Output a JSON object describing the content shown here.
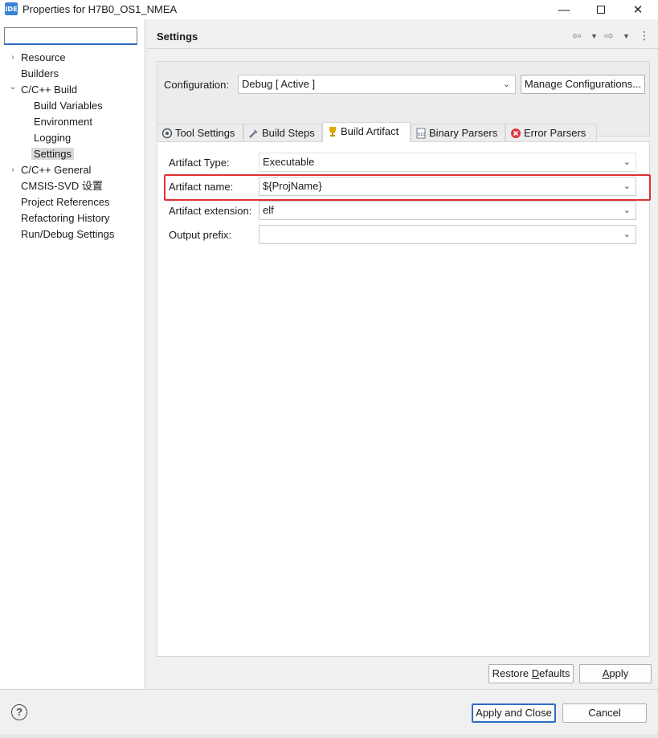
{
  "window": {
    "app_icon_text": "IDE",
    "title": "Properties for H7B0_OS1_NMEA",
    "minimize": "—",
    "close": "✕"
  },
  "filter": {
    "value": ""
  },
  "tree": [
    {
      "label": "Resource",
      "arrow": "›"
    },
    {
      "label": "Builders",
      "arrow": ""
    },
    {
      "label": "C/C++ Build",
      "arrow": "⌄"
    },
    {
      "label": "Build Variables",
      "arrow": ""
    },
    {
      "label": "Environment",
      "arrow": ""
    },
    {
      "label": "Logging",
      "arrow": ""
    },
    {
      "label": "Settings",
      "arrow": "",
      "selected": true
    },
    {
      "label": "C/C++ General",
      "arrow": "›"
    },
    {
      "label": "CMSIS-SVD 设置",
      "arrow": ""
    },
    {
      "label": "Project References",
      "arrow": ""
    },
    {
      "label": "Refactoring History",
      "arrow": ""
    },
    {
      "label": "Run/Debug Settings",
      "arrow": ""
    }
  ],
  "header": {
    "title": "Settings"
  },
  "configuration": {
    "label": "Configuration:",
    "value": "Debug  [ Active ]",
    "manage_button": "Manage Configurations..."
  },
  "tabs": [
    {
      "label": "Tool Settings",
      "icon": "tool-settings-icon"
    },
    {
      "label": "Build Steps",
      "icon": "build-steps-icon"
    },
    {
      "label": "Build Artifact",
      "icon": "trophy-icon",
      "active": true
    },
    {
      "label": "Binary Parsers",
      "icon": "binary-icon"
    },
    {
      "label": "Error Parsers",
      "icon": "error-icon"
    }
  ],
  "fields": {
    "artifact_type": {
      "label": "Artifact Type:",
      "value": "Executable"
    },
    "artifact_name": {
      "label": "Artifact name:",
      "value": "${ProjName}"
    },
    "artifact_extension": {
      "label": "Artifact extension:",
      "value": "elf"
    },
    "output_prefix": {
      "label": "Output prefix:",
      "value": ""
    }
  },
  "buttons": {
    "restore_defaults_pre": "Restore ",
    "restore_defaults_u": "D",
    "restore_defaults_post": "efaults",
    "apply_u": "A",
    "apply_post": "pply",
    "apply_and_close": "Apply and Close",
    "cancel": "Cancel",
    "help": "?"
  },
  "colors": {
    "highlight": "#e03131",
    "accent": "#2e6cc7"
  }
}
